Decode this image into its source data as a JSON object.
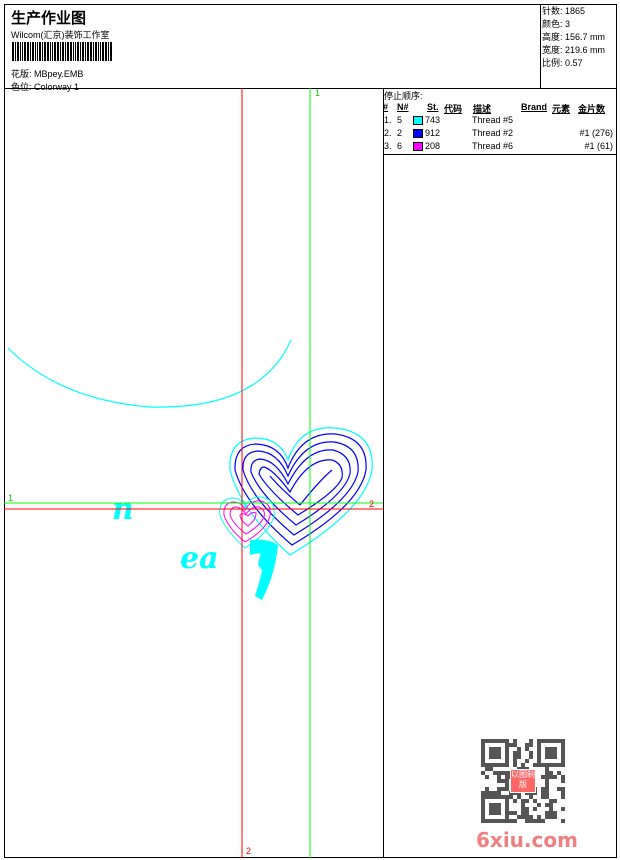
{
  "header": {
    "title": "生产作业图",
    "studio": "Wilcom(汇京)装饰工作室",
    "design_label": "花版:",
    "design_value": "MBpey.EMB",
    "colorway_label": "色位:",
    "colorway_value": "Colorway 1"
  },
  "info": [
    {
      "label": "针数:",
      "value": "1865"
    },
    {
      "label": "颜色:",
      "value": "3"
    },
    {
      "label": "高度:",
      "value": "156.7 mm"
    },
    {
      "label": "宽度:",
      "value": "219.6 mm"
    },
    {
      "label": "比例:",
      "value": "0.57"
    }
  ],
  "stop_sequence": {
    "title": "停止顺序:",
    "columns": [
      "#",
      "N#",
      "St.",
      "代码",
      "描述",
      "Brand",
      "元素",
      "金片数"
    ],
    "rows": [
      {
        "num": "1.",
        "n": "5",
        "color": "#00ffff",
        "code": "743",
        "desc": "Thread #5",
        "sequins": ""
      },
      {
        "num": "2.",
        "n": "2",
        "color": "#0000ff",
        "code": "912",
        "desc": "Thread #2",
        "sequins": "#1 (276)"
      },
      {
        "num": "3.",
        "n": "6",
        "color": "#ff00ff",
        "code": "208",
        "desc": "Thread #6",
        "sequins": "#1 (61)"
      }
    ]
  },
  "canvas": {
    "marker_1": "1",
    "marker_2": "2",
    "guide_color_1": "#00ff00",
    "guide_color_2": "#ff0000"
  },
  "watermark": "6xiu.com",
  "qr_stamp": "以图制版"
}
